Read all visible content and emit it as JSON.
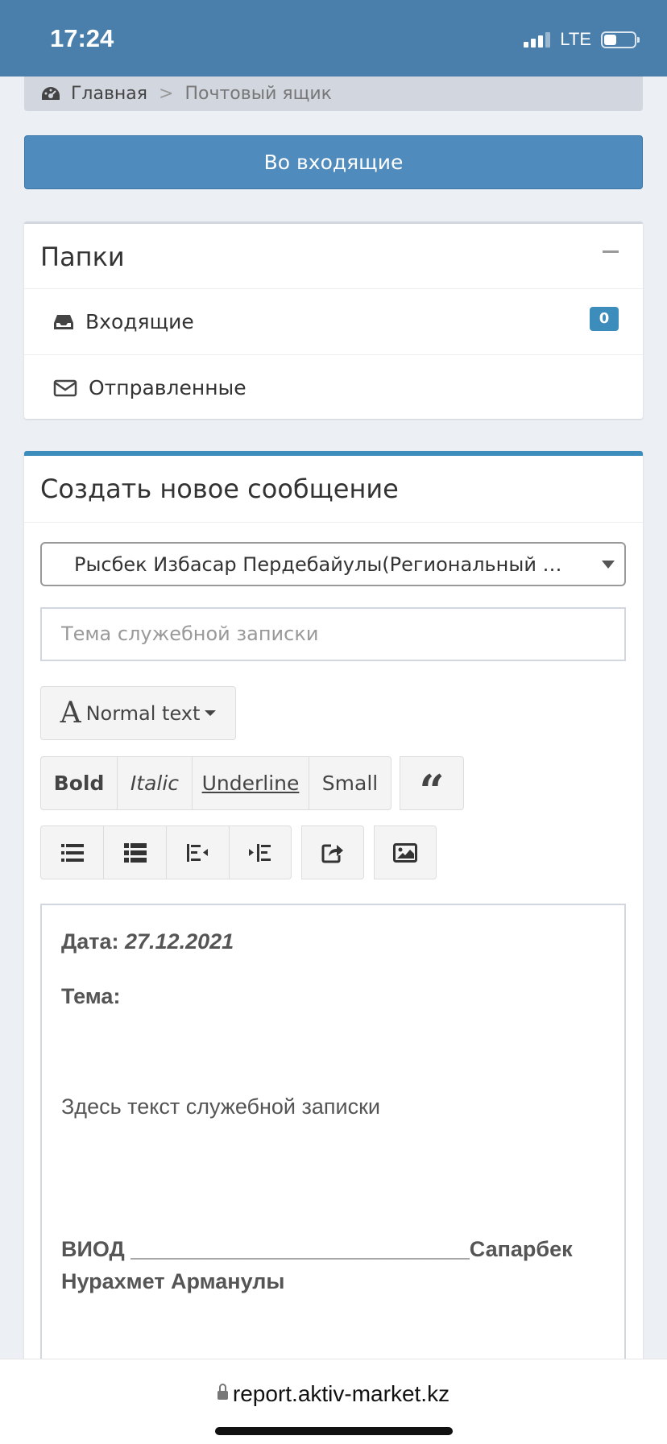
{
  "status_bar": {
    "time": "17:24",
    "network": "LTE"
  },
  "breadcrumb": {
    "home": "Главная",
    "separator": ">",
    "current": "Почтовый ящик"
  },
  "inbox_button": "Во входящие",
  "folders": {
    "title": "Папки",
    "items": [
      {
        "label": "Входящие",
        "icon": "inbox-icon",
        "count": "0"
      },
      {
        "label": "Отправленные",
        "icon": "envelope-icon"
      }
    ]
  },
  "compose": {
    "title": "Создать новое сообщение",
    "recipient": "Рысбек Избасар Пердебайулы(Региональный директор)",
    "subject_placeholder": "Тема служебной записки",
    "toolbar": {
      "text_style": "Normal text",
      "bold": "Bold",
      "italic": "Italic",
      "underline": "Underline",
      "small": "Small",
      "quote": "“"
    },
    "body": {
      "date_label": "Дата:",
      "date_value": "27.12.2021",
      "topic_label": "Тема:",
      "text": "Здесь текст служебной записки",
      "signature_line1": "ВИОД ____________________________Сапарбек",
      "signature_line2": "Нурахмет Арманулы"
    }
  },
  "browser": {
    "url": "report.aktiv-market.kz"
  },
  "colors": {
    "status_bar": "#4a7fac",
    "primary": "#3c8dbc",
    "button": "#4f8bbd"
  }
}
